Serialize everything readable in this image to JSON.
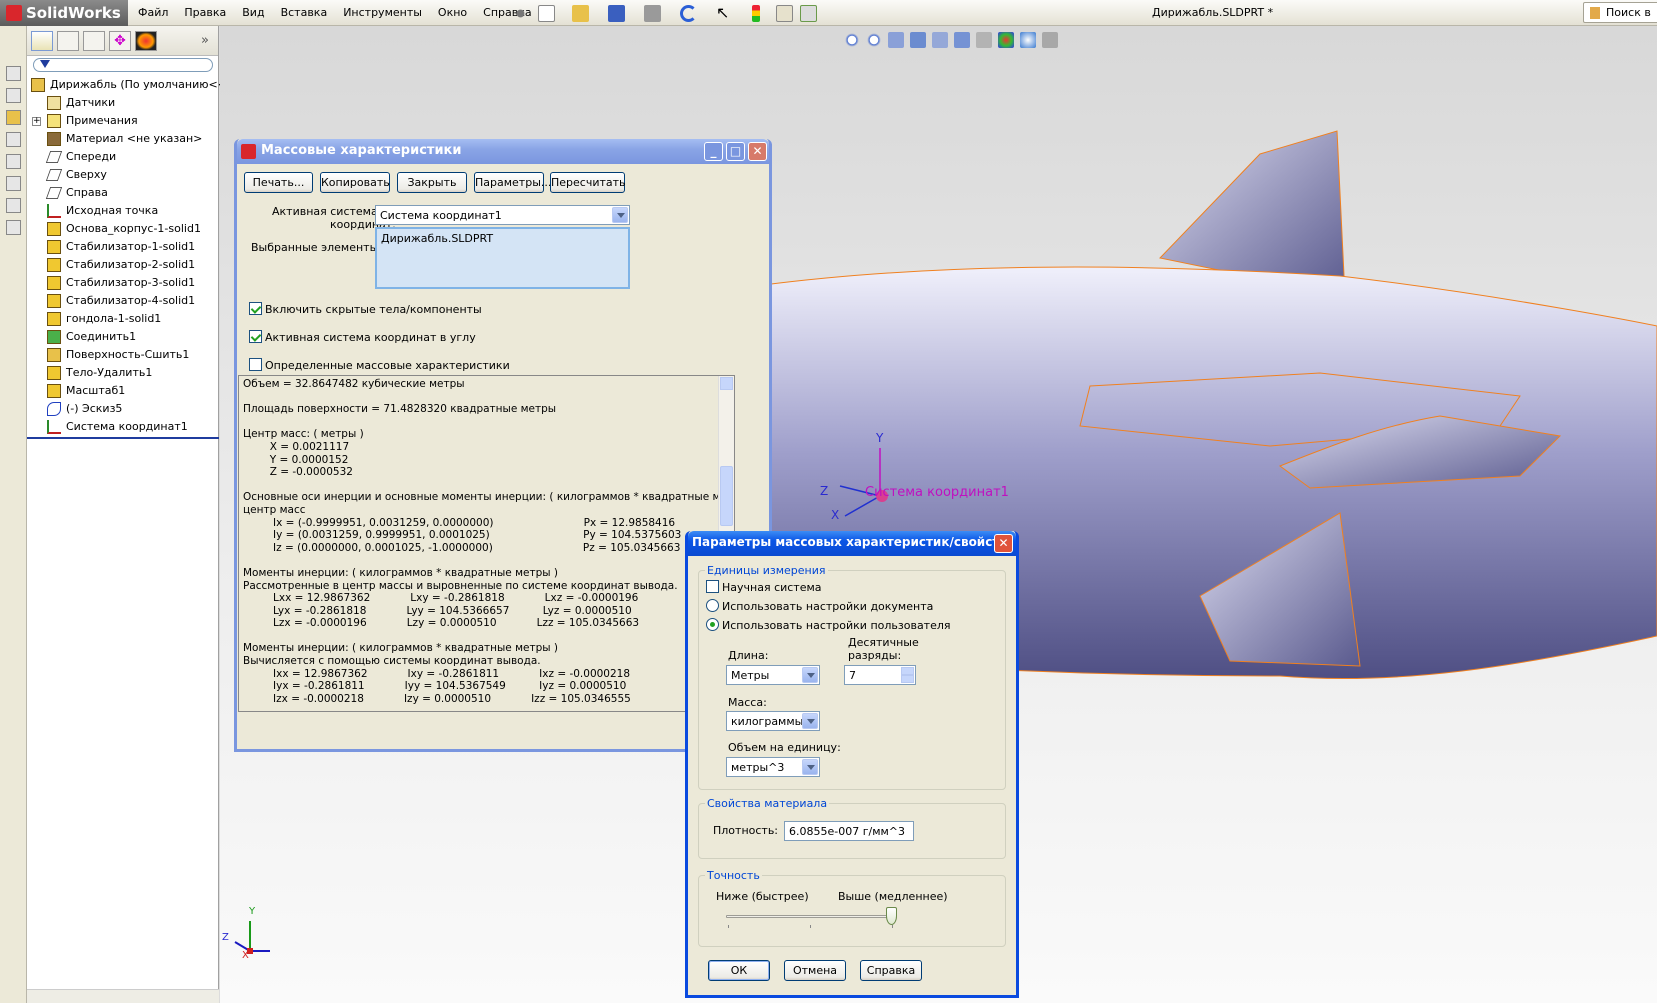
{
  "app": {
    "logo": "SolidWorks",
    "doc_title": "Дирижабль.SLDPRT *",
    "search": "Поиск в"
  },
  "menu": [
    "Файл",
    "Правка",
    "Вид",
    "Вставка",
    "Инструменты",
    "Окно",
    "Справка"
  ],
  "tree": [
    {
      "icon": "part-icon",
      "label": "Дирижабль  (По умолчанию<<По"
    },
    {
      "icon": "sensor-icon",
      "label": "Датчики"
    },
    {
      "icon": "annotation-icon",
      "label": "Примечания"
    },
    {
      "icon": "material-icon",
      "label": "Материал <не указан>"
    },
    {
      "icon": "plane-icon",
      "label": "Спереди"
    },
    {
      "icon": "plane-icon",
      "label": "Сверху"
    },
    {
      "icon": "plane-icon",
      "label": "Справа"
    },
    {
      "icon": "origin-icon",
      "label": "Исходная точка"
    },
    {
      "icon": "feature-icon",
      "label": "Основа_корпус-1-solid1"
    },
    {
      "icon": "feature-icon",
      "label": "Стабилизатор-1-solid1"
    },
    {
      "icon": "feature-icon",
      "label": "Стабилизатор-2-solid1"
    },
    {
      "icon": "feature-icon",
      "label": "Стабилизатор-3-solid1"
    },
    {
      "icon": "feature-icon",
      "label": "Стабилизатор-4-solid1"
    },
    {
      "icon": "feature-icon",
      "label": "гондола-1-solid1"
    },
    {
      "icon": "combine-icon",
      "label": "Соединить1"
    },
    {
      "icon": "knit-icon",
      "label": "Поверхность-Сшить1"
    },
    {
      "icon": "delete-body-icon",
      "label": "Тело-Удалить1"
    },
    {
      "icon": "scale-icon",
      "label": "Масштаб1"
    },
    {
      "icon": "sketch-icon",
      "label": "(-) Эскиз5"
    },
    {
      "icon": "coord-system-icon",
      "label": "Система координат1"
    }
  ],
  "mass_dialog": {
    "title": "Массовые характеристики",
    "buttons": [
      "Печать...",
      "Копировать",
      "Закрыть",
      "Параметры...",
      "Пересчитать"
    ],
    "coord_label_1": "Активная система",
    "coord_label_2": "координат:",
    "coord_value": "Система координат1",
    "selected_label": "Выбранные элементы:",
    "selected_value": "Дирижабль.SLDPRT",
    "checks": [
      {
        "label": "Включить скрытые тела/компоненты",
        "checked": true
      },
      {
        "label": "Активная система координат в углу",
        "checked": true
      },
      {
        "label": "Определенные массовые характеристики",
        "checked": false
      }
    ],
    "results": [
      "Объем = 32.8647482 кубические метры",
      "",
      "Площадь поверхности = 71.4828320 квадратные метры",
      "",
      "Центр масс: ( метры )",
      "        X = 0.0021117",
      "        Y = 0.0000152",
      "        Z = -0.0000532",
      "",
      "Основные оси инерции и основные моменты инерции: ( килограммов * квадратные метры )",
      "центр масс",
      "         Ix = (-0.9999951, 0.0031259, 0.0000000)                           Px = 12.9858416",
      "         Iy = (0.0031259, 0.9999951, 0.0001025)                            Py = 104.5375603",
      "         Iz = (0.0000000, 0.0001025, -1.0000000)                           Pz = 105.0345663",
      "",
      "Моменты инерции: ( килограммов * квадратные метры )",
      "Рассмотренные в центр массы и выровненные по системе координат вывода.",
      "         Lxx = 12.9867362            Lxy = -0.2861818            Lxz = -0.0000196",
      "         Lyx = -0.2861818            Lyy = 104.5366657          Lyz = 0.0000510",
      "         Lzx = -0.0000196            Lzy = 0.0000510            Lzz = 105.0345663",
      "",
      "Моменты инерции: ( килограммов * квадратные метры )",
      "Вычисляется с помощью системы координат вывода.",
      "         Ixx = 12.9867362            Ixy = -0.2861811            Ixz = -0.0000218",
      "         Iyx = -0.2861811            Iyy = 104.5367549          Iyz = 0.0000510",
      "         Izx = -0.0000218            Izy = 0.0000510            Izz = 105.0346555"
    ]
  },
  "params_dialog": {
    "title": "Параметры массовых характеристик/свойст...",
    "units_group": "Единицы измерения",
    "scientific": "Научная система",
    "use_doc": "Использовать настройки документа",
    "use_user": "Использовать настройки пользователя",
    "length_label": "Длина:",
    "length_value": "Метры",
    "decimals_label_1": "Десятичные",
    "decimals_label_2": "разряды:",
    "decimals_value": "7",
    "mass_label": "Масса:",
    "mass_value": "килограммы",
    "volume_label": "Объем на единицу:",
    "volume_value": "метры^3",
    "material_group": "Свойства материала",
    "density_label": "Плотность:",
    "density_value": "6.0855e-007 г/мм^3",
    "accuracy_group": "Точность",
    "low_label": "Ниже (быстрее)",
    "high_label": "Выше (медленнее)",
    "accuracy_level": 1.0,
    "ok": "ОК",
    "cancel": "Отмена",
    "help": "Справка"
  },
  "viewport": {
    "coord_label": "Система координат1",
    "axis_x": "X",
    "axis_y": "Y",
    "axis_z": "Z",
    "triad_x": "X",
    "triad_y": "Y",
    "triad_z": "Z"
  }
}
